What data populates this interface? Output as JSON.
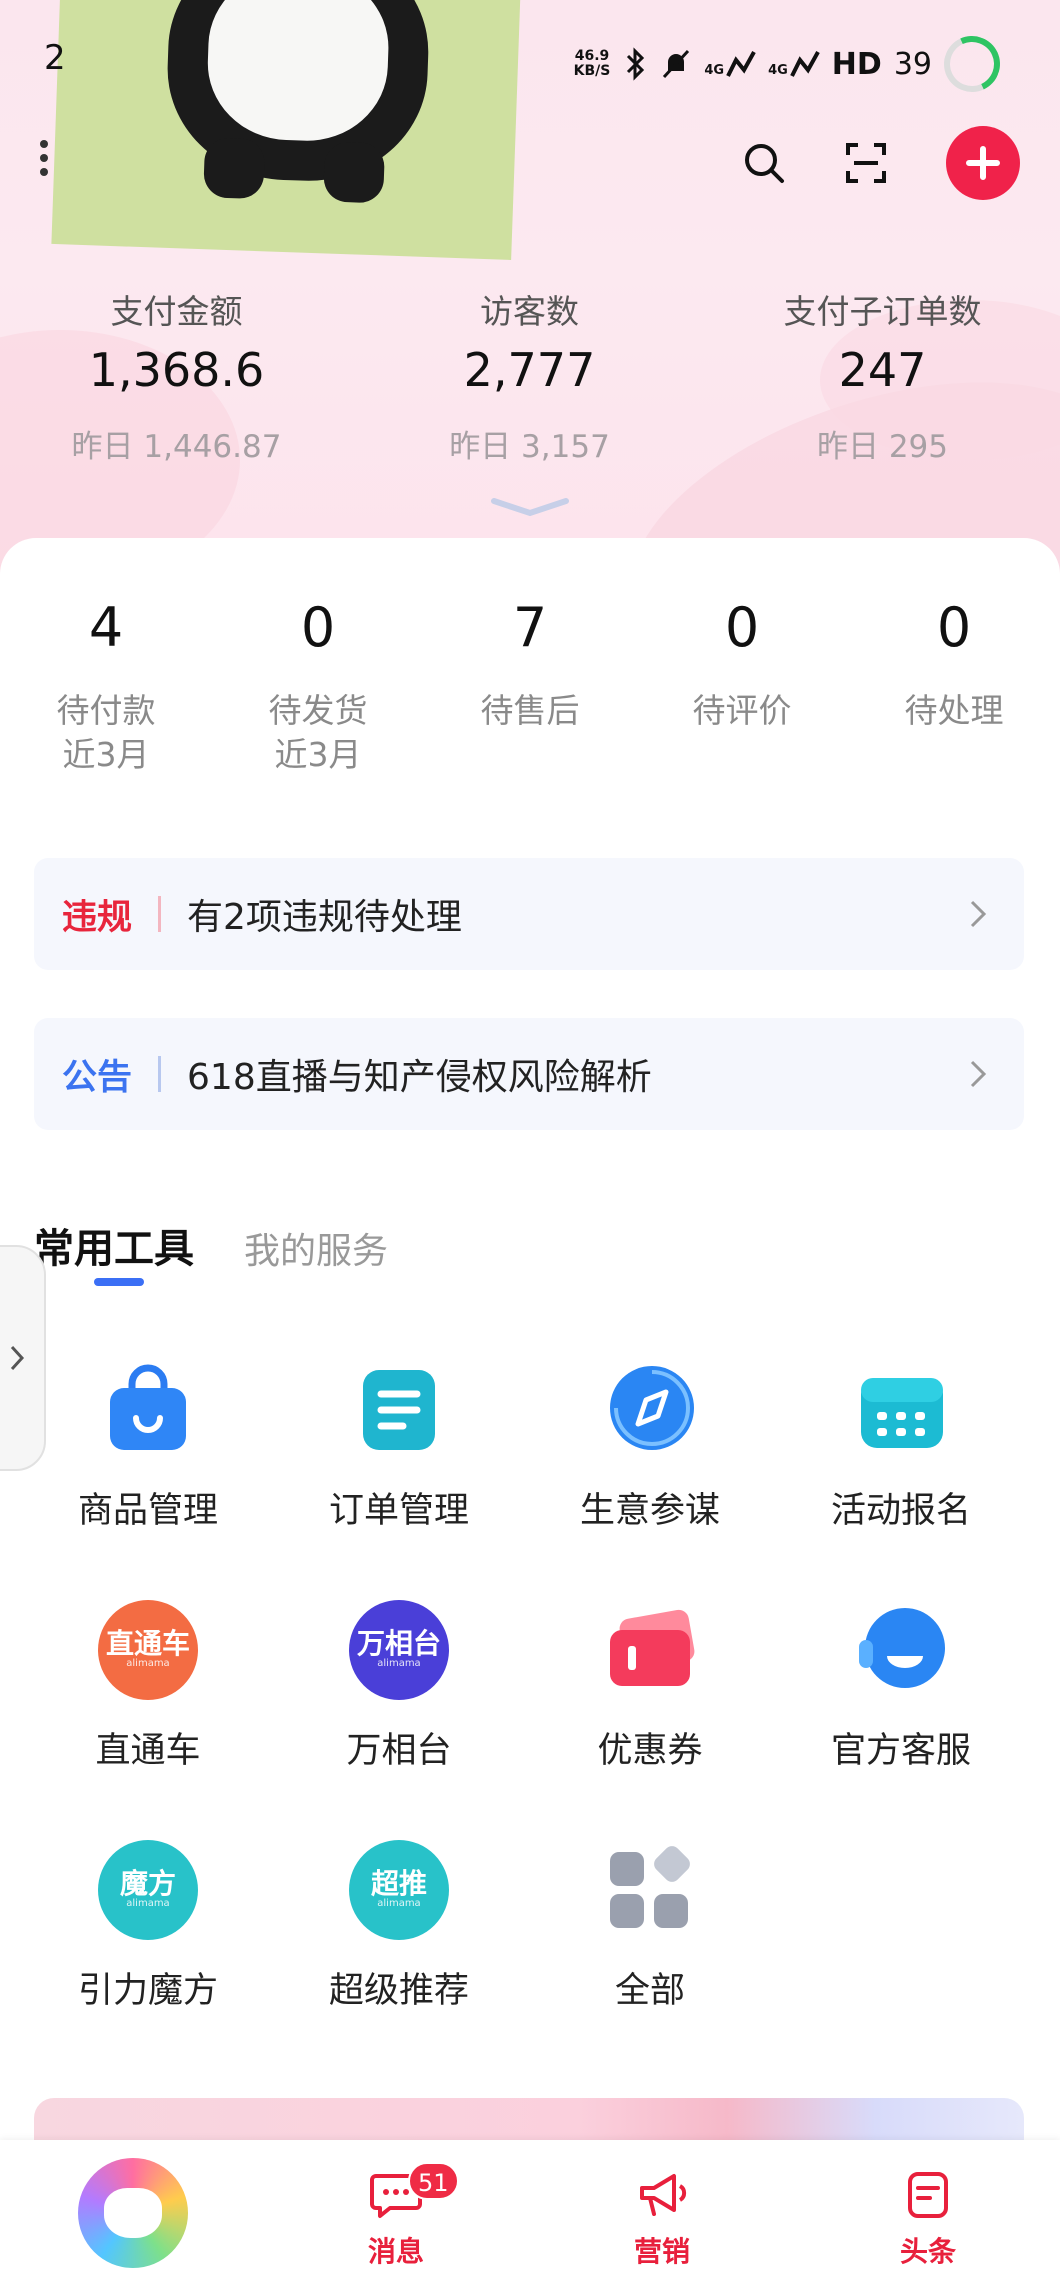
{
  "status_bar": {
    "time": "2",
    "net_speed_value": "46.9",
    "net_speed_unit": "KB/S",
    "network_1": "4G",
    "network_2": "4G",
    "hd_label": "HD",
    "battery": "39"
  },
  "header": {
    "actions": [
      "search-icon",
      "scan-icon",
      "add-icon"
    ]
  },
  "kpis": [
    {
      "label": "支付金额",
      "value": "1,368.6",
      "prev": "昨日 1,446.87"
    },
    {
      "label": "访客数",
      "value": "2,777",
      "prev": "昨日 3,157"
    },
    {
      "label": "支付子订单数",
      "value": "247",
      "prev": "昨日 295"
    }
  ],
  "orders": [
    {
      "count": "4",
      "label": "待付款",
      "sub": "近3月"
    },
    {
      "count": "0",
      "label": "待发货",
      "sub": "近3月"
    },
    {
      "count": "7",
      "label": "待售后",
      "sub": ""
    },
    {
      "count": "0",
      "label": "待评价",
      "sub": ""
    },
    {
      "count": "0",
      "label": "待处理",
      "sub": ""
    }
  ],
  "notices": [
    {
      "tag": "违规",
      "text": "有2项违规待处理",
      "color": "#e8253c"
    },
    {
      "tag": "公告",
      "text": "618直播与知产侵权风险解析",
      "color": "#3b73f0"
    }
  ],
  "tabs": {
    "active": "常用工具",
    "inactive": "我的服务"
  },
  "tools": [
    {
      "name": "商品管理",
      "icon": "bag-icon"
    },
    {
      "name": "订单管理",
      "icon": "document-icon"
    },
    {
      "name": "生意参谋",
      "icon": "compass-icon"
    },
    {
      "name": "活动报名",
      "icon": "calendar-icon"
    },
    {
      "name": "直通车",
      "icon": "ztc-icon",
      "badge_text": "直通车",
      "badge_sub": "alimama"
    },
    {
      "name": "万相台",
      "icon": "wxt-icon",
      "badge_text": "万相台",
      "badge_sub": "alimama"
    },
    {
      "name": "优惠券",
      "icon": "coupon-icon"
    },
    {
      "name": "官方客服",
      "icon": "headset-icon"
    },
    {
      "name": "引力魔方",
      "icon": "mofang-icon",
      "badge_text": "魔方",
      "badge_sub": "alimama"
    },
    {
      "name": "超级推荐",
      "icon": "chaotui-icon",
      "badge_text": "超推",
      "badge_sub": "alimama"
    },
    {
      "name": "全部",
      "icon": "all-apps-icon"
    }
  ],
  "bottom_nav": [
    {
      "label": "",
      "icon": "home-logo-icon"
    },
    {
      "label": "消息",
      "icon": "message-icon",
      "badge": "51"
    },
    {
      "label": "营销",
      "icon": "megaphone-icon"
    },
    {
      "label": "头条",
      "icon": "news-icon"
    }
  ],
  "colors": {
    "brand_red": "#f0224a",
    "blue": "#3b6ff5",
    "pink_bg": "#fbe6ee"
  }
}
